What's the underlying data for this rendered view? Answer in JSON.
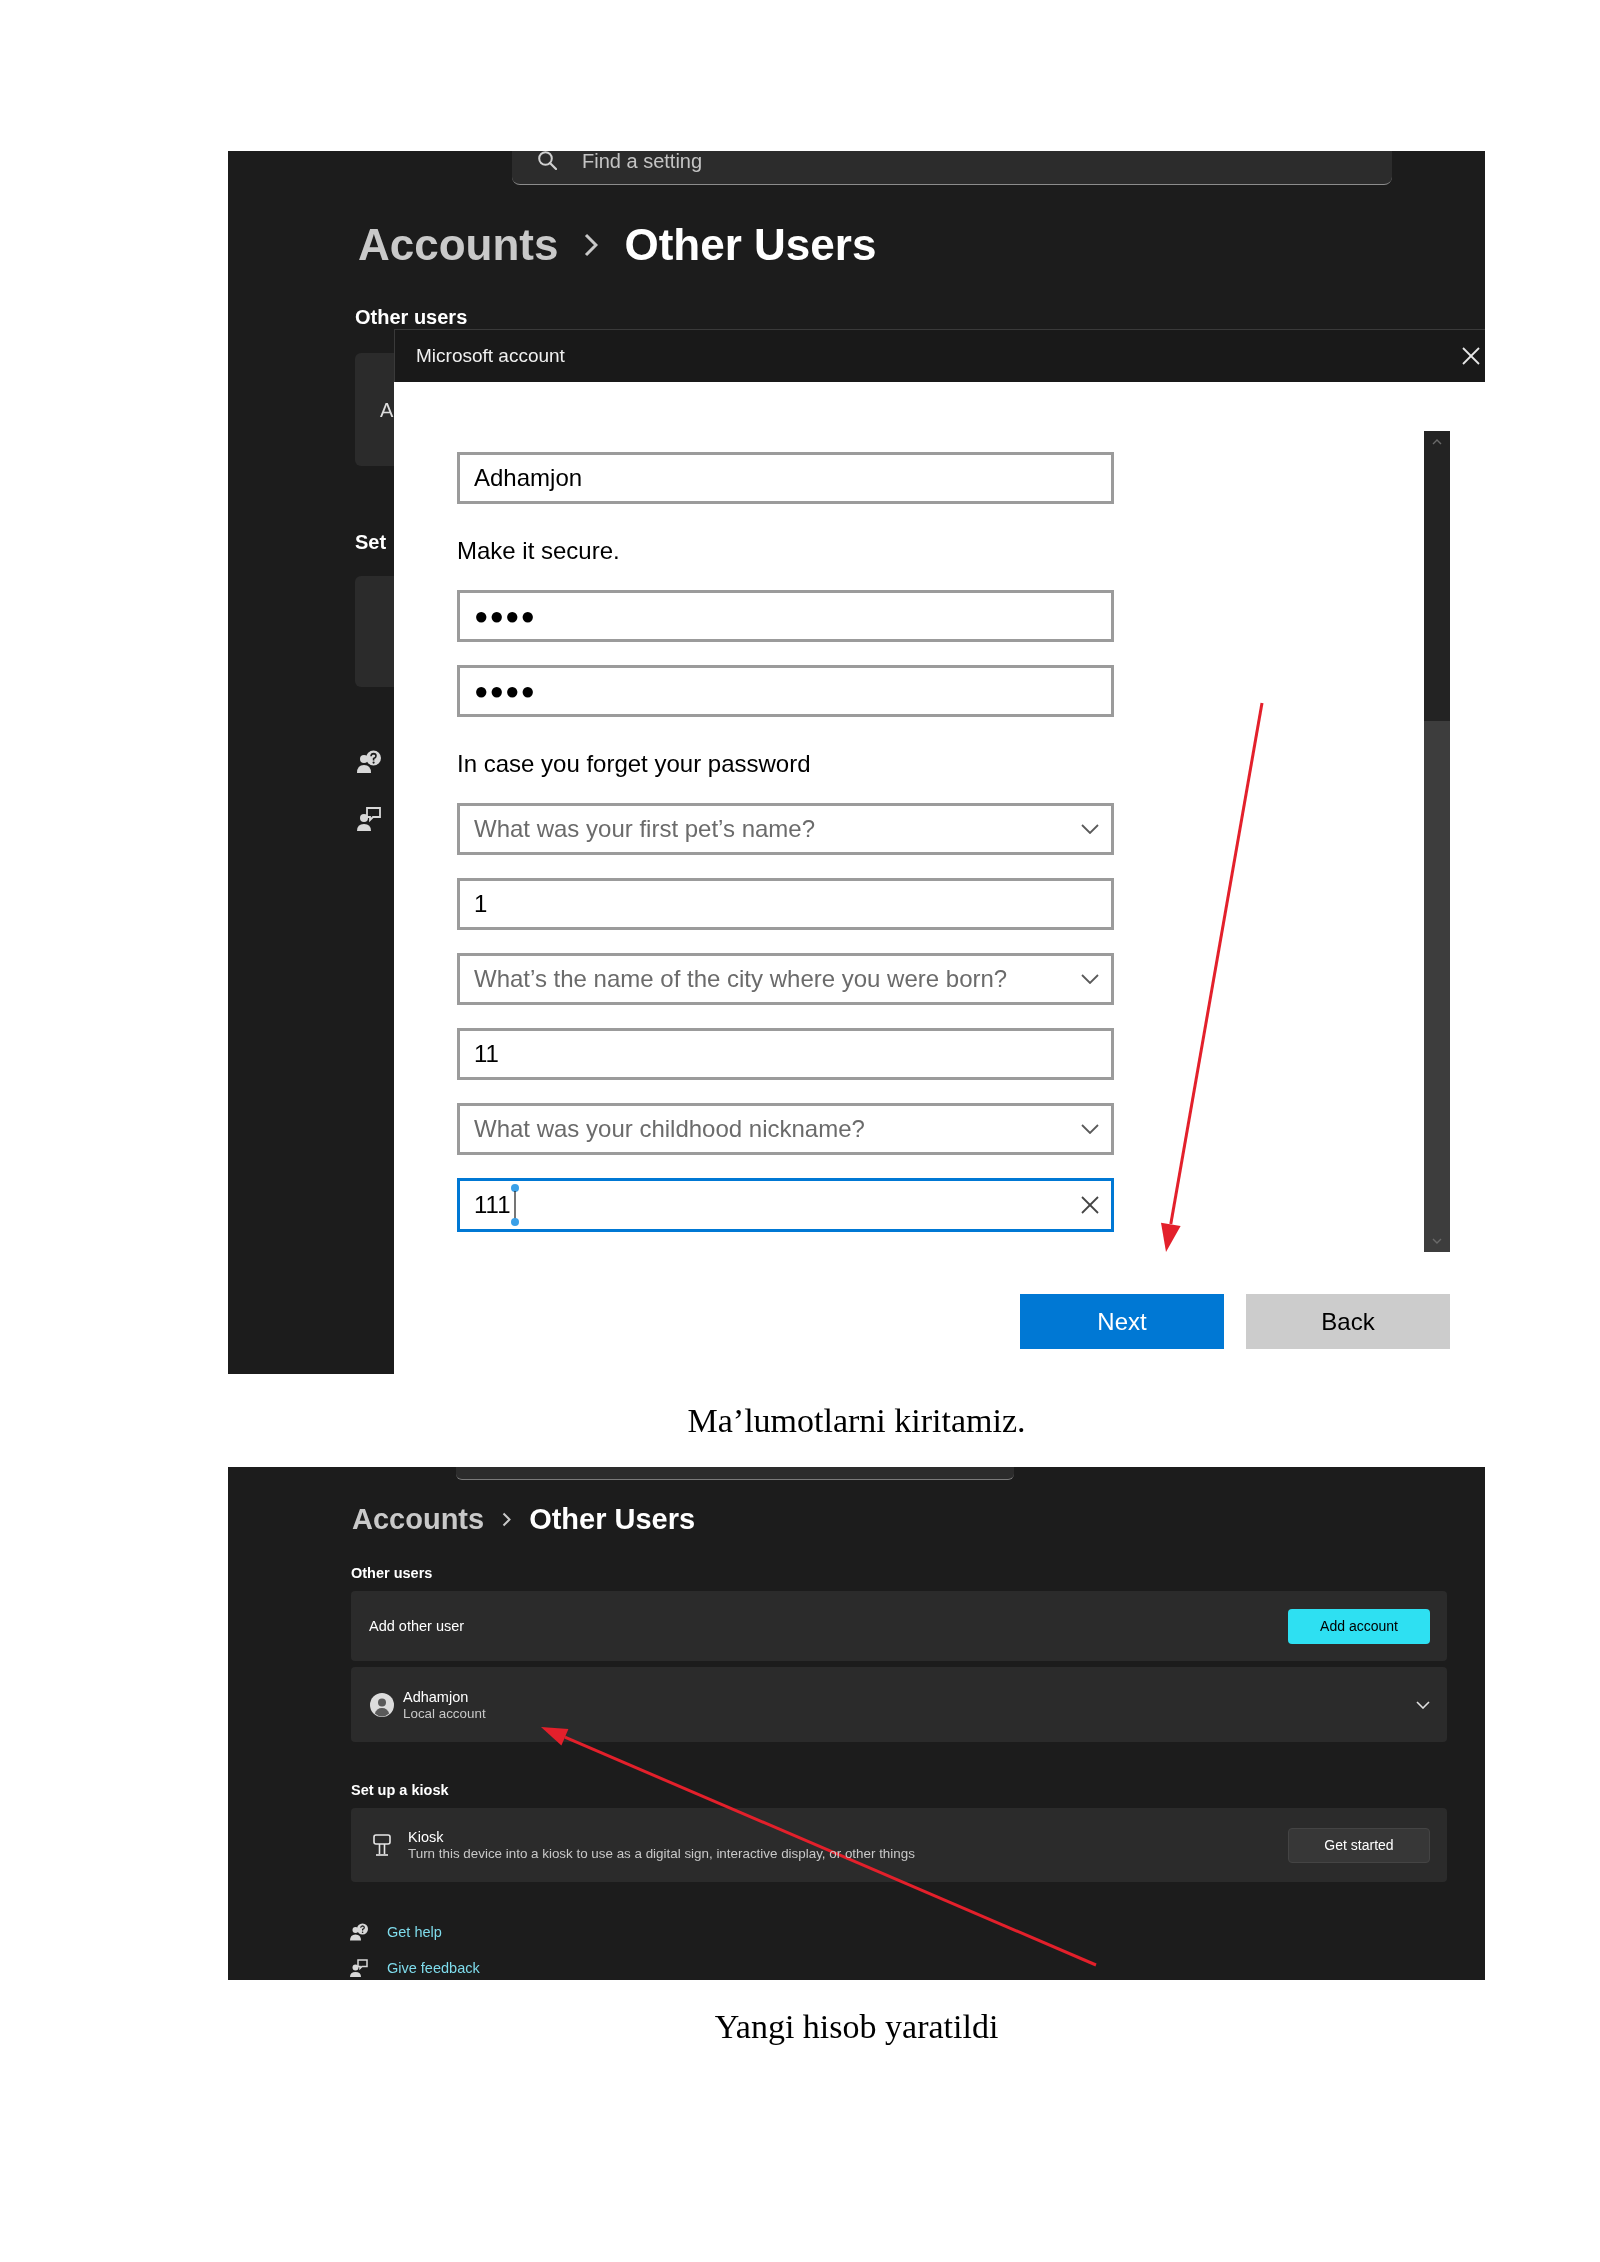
{
  "figures": [
    {
      "kind": "dialog_screenshot",
      "settings": {
        "search": {
          "placeholder": "Find a setting"
        },
        "breadcrumb": [
          "Accounts",
          "Other Users"
        ],
        "heading": "Other users",
        "partial_card_text": "A",
        "partial_heading": "Set"
      },
      "dialog": {
        "title": "Microsoft account",
        "form": [
          {
            "kind": "input",
            "value": "Adhamjon",
            "focused": false
          },
          {
            "kind": "label",
            "text": "Make it secure."
          },
          {
            "kind": "password",
            "value": "●●●●",
            "focused": false
          },
          {
            "kind": "password",
            "value": "●●●●",
            "focused": false
          },
          {
            "kind": "label",
            "text": "In case you forget your password"
          },
          {
            "kind": "select",
            "value": "What was your first pet’s name?"
          },
          {
            "kind": "input",
            "value": "1",
            "focused": false
          },
          {
            "kind": "select",
            "value": "What’s the name of the city where you were born?"
          },
          {
            "kind": "input",
            "value": "11",
            "focused": false
          },
          {
            "kind": "select",
            "value": "What was your childhood nickname?"
          },
          {
            "kind": "input",
            "value": "111",
            "focused": true
          }
        ],
        "buttons": [
          {
            "label": "Next",
            "kind": "primary"
          },
          {
            "label": "Back",
            "kind": "secondary"
          }
        ]
      },
      "caption": "Ma’lumotlarni kiritamiz."
    },
    {
      "kind": "settings_screenshot",
      "breadcrumb": [
        "Accounts",
        "Other Users"
      ],
      "sections": [
        {
          "heading": "Other users",
          "rows": [
            {
              "kind": "action",
              "title": "Add other user",
              "button": {
                "label": "Add account",
                "kind": "accent"
              }
            },
            {
              "kind": "account",
              "title": "Adhamjon",
              "subtitle": "Local account",
              "expanded": false
            }
          ]
        },
        {
          "heading": "Set up a kiosk",
          "rows": [
            {
              "kind": "kiosk",
              "title": "Kiosk",
              "subtitle": "Turn this device into a kiosk to use as a digital sign, interactive display, or other things",
              "button": {
                "label": "Get started",
                "kind": "standard"
              }
            }
          ]
        }
      ],
      "links": [
        {
          "kind": "help",
          "label": "Get help"
        },
        {
          "kind": "feedback",
          "label": "Give feedback"
        }
      ],
      "caption": "Yangi hisob yaratildi"
    }
  ]
}
